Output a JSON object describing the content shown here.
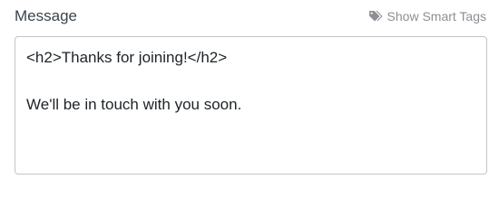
{
  "field": {
    "label": "Message",
    "smart_tags_label": "Show Smart Tags",
    "smart_tags_icon": "tags-icon",
    "value": "<h2>Thanks for joining!</h2>\n\nWe'll be in touch with you soon."
  },
  "colors": {
    "label_text": "#3c434a",
    "muted_text": "#8c8f94",
    "border": "#c3c4c7"
  }
}
